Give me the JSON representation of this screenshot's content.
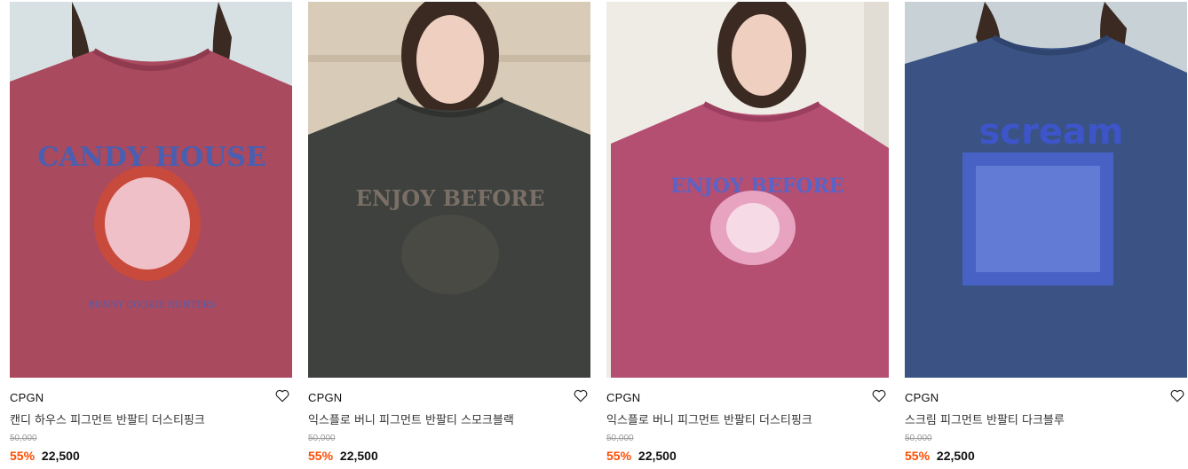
{
  "products": [
    {
      "brand": "CPGN",
      "name": "캔디 하우스 피그먼트 반팔티 더스티핑크",
      "original_price": "50,000",
      "discount": "55%",
      "price": "22,500",
      "shirt_text": "CANDY HOUSE",
      "shirt_color": "#a94a5f",
      "bg_color": "#cfd8dc",
      "print_color": "#4b5fb0"
    },
    {
      "brand": "CPGN",
      "name": "익스플로 버니 피그먼트 반팔티 스모크블랙",
      "original_price": "50,000",
      "discount": "55%",
      "price": "22,500",
      "shirt_text": "ENJOY BEFORE",
      "shirt_color": "#3e413d",
      "bg_color": "#d8cbb8",
      "print_color": "#7a6f66"
    },
    {
      "brand": "CPGN",
      "name": "익스플로 버니 피그먼트 반팔티 더스티핑크",
      "original_price": "50,000",
      "discount": "55%",
      "price": "22,500",
      "shirt_text": "ENJOY BEFORE",
      "shirt_color": "#b44f72",
      "bg_color": "#efece6",
      "print_color": "#5b63c4"
    },
    {
      "brand": "CPGN",
      "name": "스크림 피그먼트 반팔티 다크블루",
      "original_price": "50,000",
      "discount": "55%",
      "price": "22,500",
      "shirt_text": "scream",
      "shirt_color": "#3a5384",
      "bg_color": "#c7d1d6",
      "print_color": "#3d55c9"
    }
  ]
}
